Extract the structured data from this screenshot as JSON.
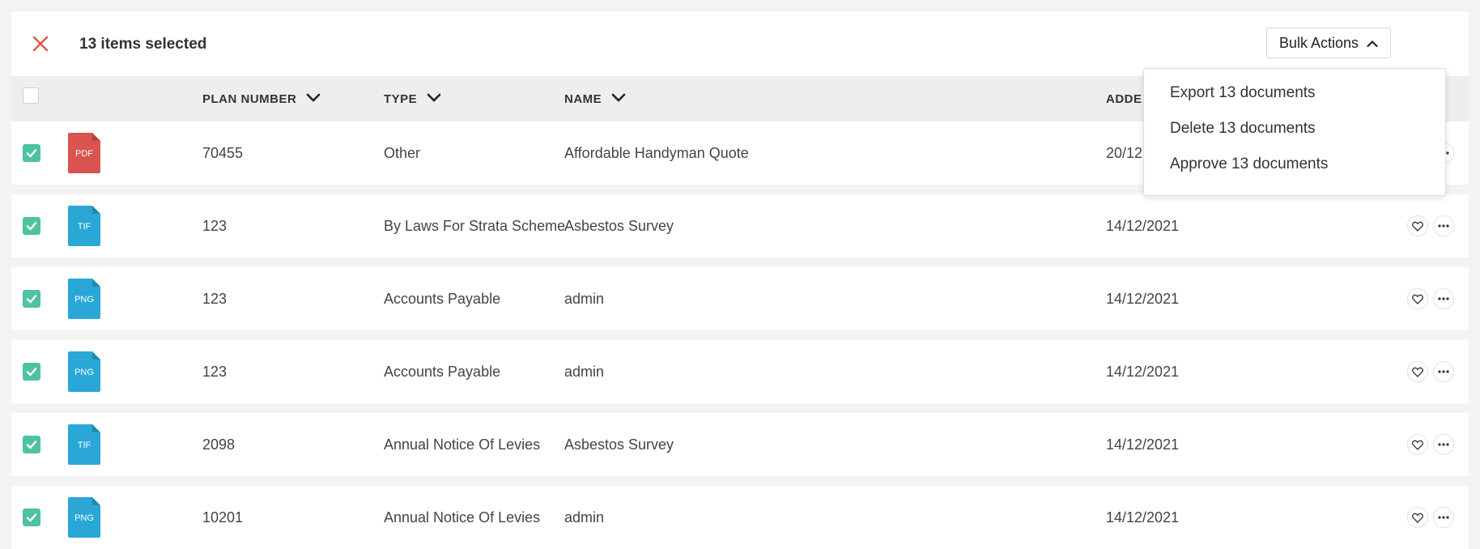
{
  "selection": {
    "count_label": "13 items selected"
  },
  "bulk_actions": {
    "label": "Bulk Actions",
    "menu": [
      "Export 13 documents",
      "Delete 13 documents",
      "Approve 13 documents"
    ]
  },
  "columns": {
    "plan_number": "PLAN NUMBER",
    "type": "TYPE",
    "name": "NAME",
    "added": "ADDE"
  },
  "rows": [
    {
      "file_type": "PDF",
      "plan": "70455",
      "type": "Other",
      "name": "Affordable Handyman Quote",
      "date": "20/12"
    },
    {
      "file_type": "TIF",
      "plan": "123",
      "type": "By Laws For Strata Scheme",
      "name": "Asbestos Survey",
      "date": "14/12/2021"
    },
    {
      "file_type": "PNG",
      "plan": "123",
      "type": "Accounts Payable",
      "name": "admin",
      "date": "14/12/2021"
    },
    {
      "file_type": "PNG",
      "plan": "123",
      "type": "Accounts Payable",
      "name": "admin",
      "date": "14/12/2021"
    },
    {
      "file_type": "TIF",
      "plan": "2098",
      "type": "Annual Notice Of Levies",
      "name": "Asbestos Survey",
      "date": "14/12/2021"
    },
    {
      "file_type": "PNG",
      "plan": "10201",
      "type": "Annual Notice Of Levies",
      "name": "admin",
      "date": "14/12/2021"
    }
  ],
  "colors": {
    "accent_green": "#4fc3a1",
    "pdf_red": "#d9534f",
    "image_blue": "#2aa7d6",
    "close_red": "#e0554d"
  }
}
